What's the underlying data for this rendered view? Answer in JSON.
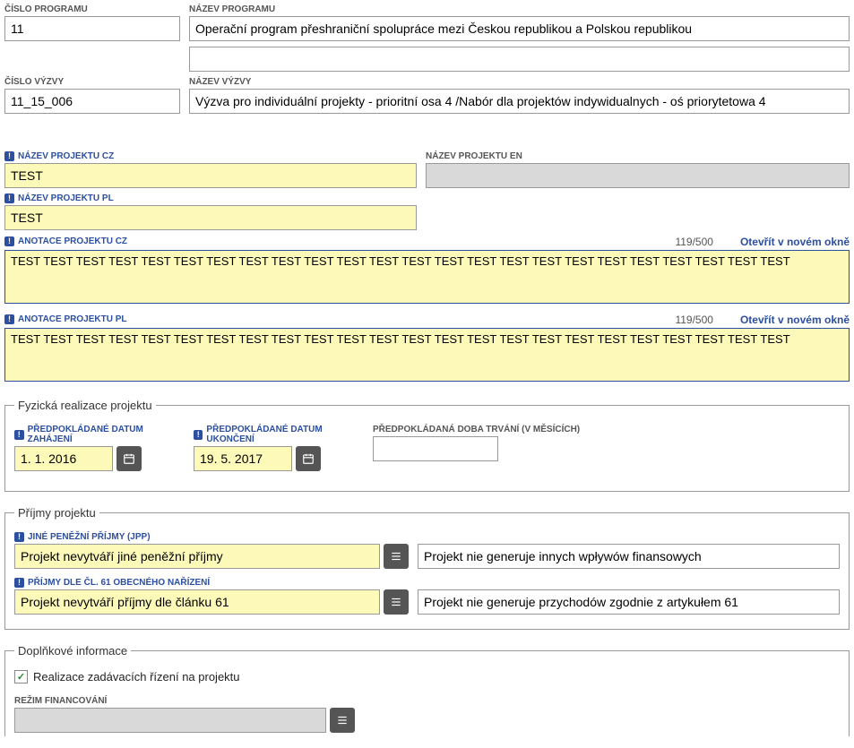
{
  "program": {
    "cislo_label": "Číslo programu",
    "cislo_value": "11",
    "nazev_label": "Název programu",
    "nazev_value": "Operační program přeshraniční spolupráce mezi Českou republikou a Polskou republikou",
    "extra_value": ""
  },
  "vyzva": {
    "cislo_label": "Číslo výzvy",
    "cislo_value": "11_15_006",
    "nazev_label": "Název výzvy",
    "nazev_value": "Výzva pro individuální projekty - prioritní osa 4 /Nabór dla projektów indywidualnych - oś priorytetowa 4"
  },
  "project": {
    "nazev_cz_label": "Název projektu CZ",
    "nazev_cz_value": "TEST",
    "nazev_en_label": "Název projektu EN",
    "nazev_en_value": "",
    "nazev_pl_label": "Název projektu PL",
    "nazev_pl_value": "TEST",
    "anotace_cz_label": "Anotace projektu CZ",
    "anotace_cz_value": "TEST TEST TEST TEST TEST TEST TEST TEST TEST TEST TEST TEST TEST TEST TEST TEST TEST TEST TEST TEST TEST TEST TEST TEST",
    "anotace_cz_counter": "119/500",
    "anotace_pl_label": "Anotace projektu PL",
    "anotace_pl_value": "TEST TEST TEST TEST TEST TEST TEST TEST TEST TEST TEST TEST TEST TEST TEST TEST TEST TEST TEST TEST TEST TEST TEST TEST",
    "anotace_pl_counter": "119/500",
    "open_new_window": "Otevřít v novém okně"
  },
  "realizace": {
    "legend": "Fyzická realizace projektu",
    "zahajeni_label": "Předpokládané datum zahájení",
    "zahajeni_value": "1. 1. 2016",
    "ukonceni_label": "Předpokládané datum ukončení",
    "ukonceni_value": "19. 5. 2017",
    "doba_label": "Předpokládaná doba trvání (v měsících)",
    "doba_value": ""
  },
  "prijmy": {
    "legend": "Příjmy projektu",
    "jpp_label": "Jiné peněžní příjmy (JPP)",
    "jpp_value": "Projekt nevytváří jiné peněžní příjmy",
    "jpp_translation": "Projekt nie generuje innych wpływów finansowych",
    "cl61_label": "Příjmy dle čl. 61 obecného nařízení",
    "cl61_value": "Projekt nevytváří příjmy dle článku 61",
    "cl61_translation": "Projekt nie generuje przychodów zgodnie z artykułem 61"
  },
  "doplnkove": {
    "legend": "Doplňkové informace",
    "checkbox_label": "Realizace zadávacích řízení na projektu",
    "checkbox_checked": true,
    "rezim_label": "Režim financování",
    "rezim_value": ""
  }
}
